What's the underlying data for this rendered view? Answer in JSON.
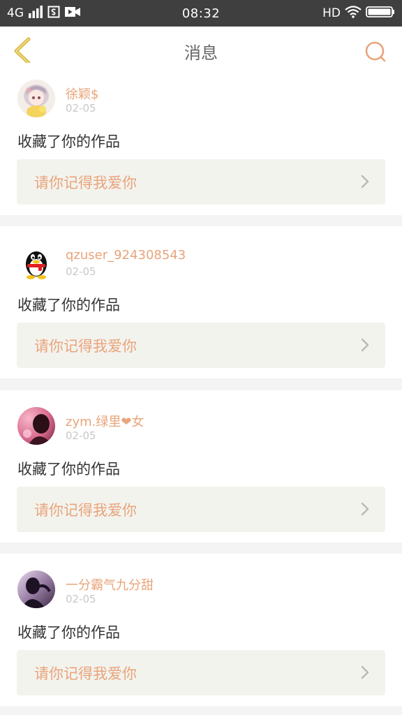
{
  "status_bar": {
    "network": "4G",
    "time": "08:32",
    "hd": "HD"
  },
  "header": {
    "title": "消息",
    "back_icon": "chevron-left-icon",
    "search_icon": "search-icon"
  },
  "colors": {
    "accent": "#e8a47a",
    "back_icon": "#d9b84a",
    "header_bg": "#ffffff",
    "status_bar_bg": "#3f3f3f",
    "page_bg": "#f4f4f4",
    "link_bg": "#f3f3ee"
  },
  "messages": [
    {
      "username": "徐颖$",
      "date": "02-05",
      "action": "收藏了你的作品",
      "work_title": "请你记得我爱你",
      "avatar": "anime-girl-avatar"
    },
    {
      "username": "qzuser_924308543",
      "date": "02-05",
      "action": "收藏了你的作品",
      "work_title": "请你记得我爱你",
      "avatar": "penguin-avatar"
    },
    {
      "username": "zym.绿里❤女",
      "date": "02-05",
      "action": "收藏了你的作品",
      "work_title": "请你记得我爱你",
      "avatar": "pink-photo-avatar"
    },
    {
      "username": "一分霸气九分甜",
      "date": "02-05",
      "action": "收藏了你的作品",
      "work_title": "请你记得我爱你",
      "avatar": "purple-photo-avatar"
    }
  ]
}
